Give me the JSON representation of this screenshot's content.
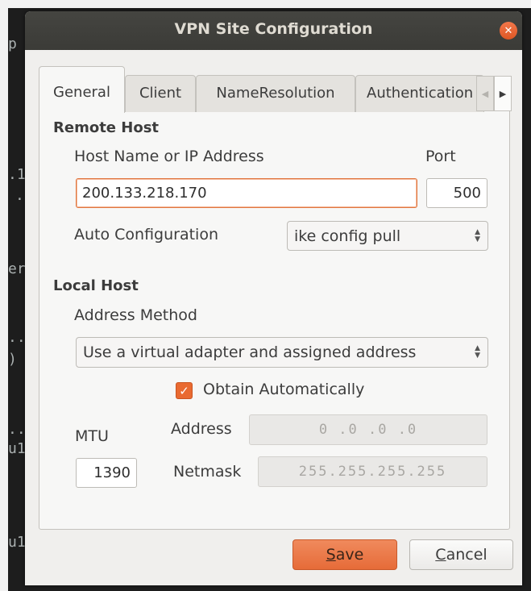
{
  "terminal": {
    "lines": [
      "p",
      ".1",
      ".",
      "er",
      "..",
      ")",
      "..",
      "u1",
      "u1"
    ]
  },
  "window": {
    "title": "VPN Site Configuration",
    "close_icon": "close-icon"
  },
  "tabs": [
    {
      "label": "General",
      "active": true
    },
    {
      "label": "Client",
      "active": false
    },
    {
      "label": "NameResolution",
      "active": false
    },
    {
      "label": "Authentication",
      "active": false
    }
  ],
  "tab_scroll": {
    "left_icon": "tab-scroll-left-icon",
    "right_icon": "tab-scroll-right-icon"
  },
  "remote_host": {
    "section_title": "Remote Host",
    "host_label": "Host Name or IP Address",
    "host_value": "200.133.218.170",
    "port_label": "Port",
    "port_value": "500",
    "auto_config_label": "Auto Configuration",
    "auto_config_value": "ike config pull"
  },
  "local_host": {
    "section_title": "Local Host",
    "address_method_label": "Address Method",
    "address_method_value": "Use a virtual adapter and assigned address",
    "obtain_auto_label": "Obtain Automatically",
    "obtain_auto_checked": true,
    "mtu_label": "MTU",
    "mtu_value": "1390",
    "address_label": "Address",
    "address_value": "0 .0 .0 .0",
    "netmask_label": "Netmask",
    "netmask_value": "255.255.255.255"
  },
  "buttons": {
    "save_mnemonic": "S",
    "save_rest": "ave",
    "cancel_mnemonic": "C",
    "cancel_rest": "ancel"
  },
  "colors": {
    "accent": "#e96a31",
    "titlebar": "#3b3b37",
    "terminal_bg": "#1d1d1d"
  }
}
